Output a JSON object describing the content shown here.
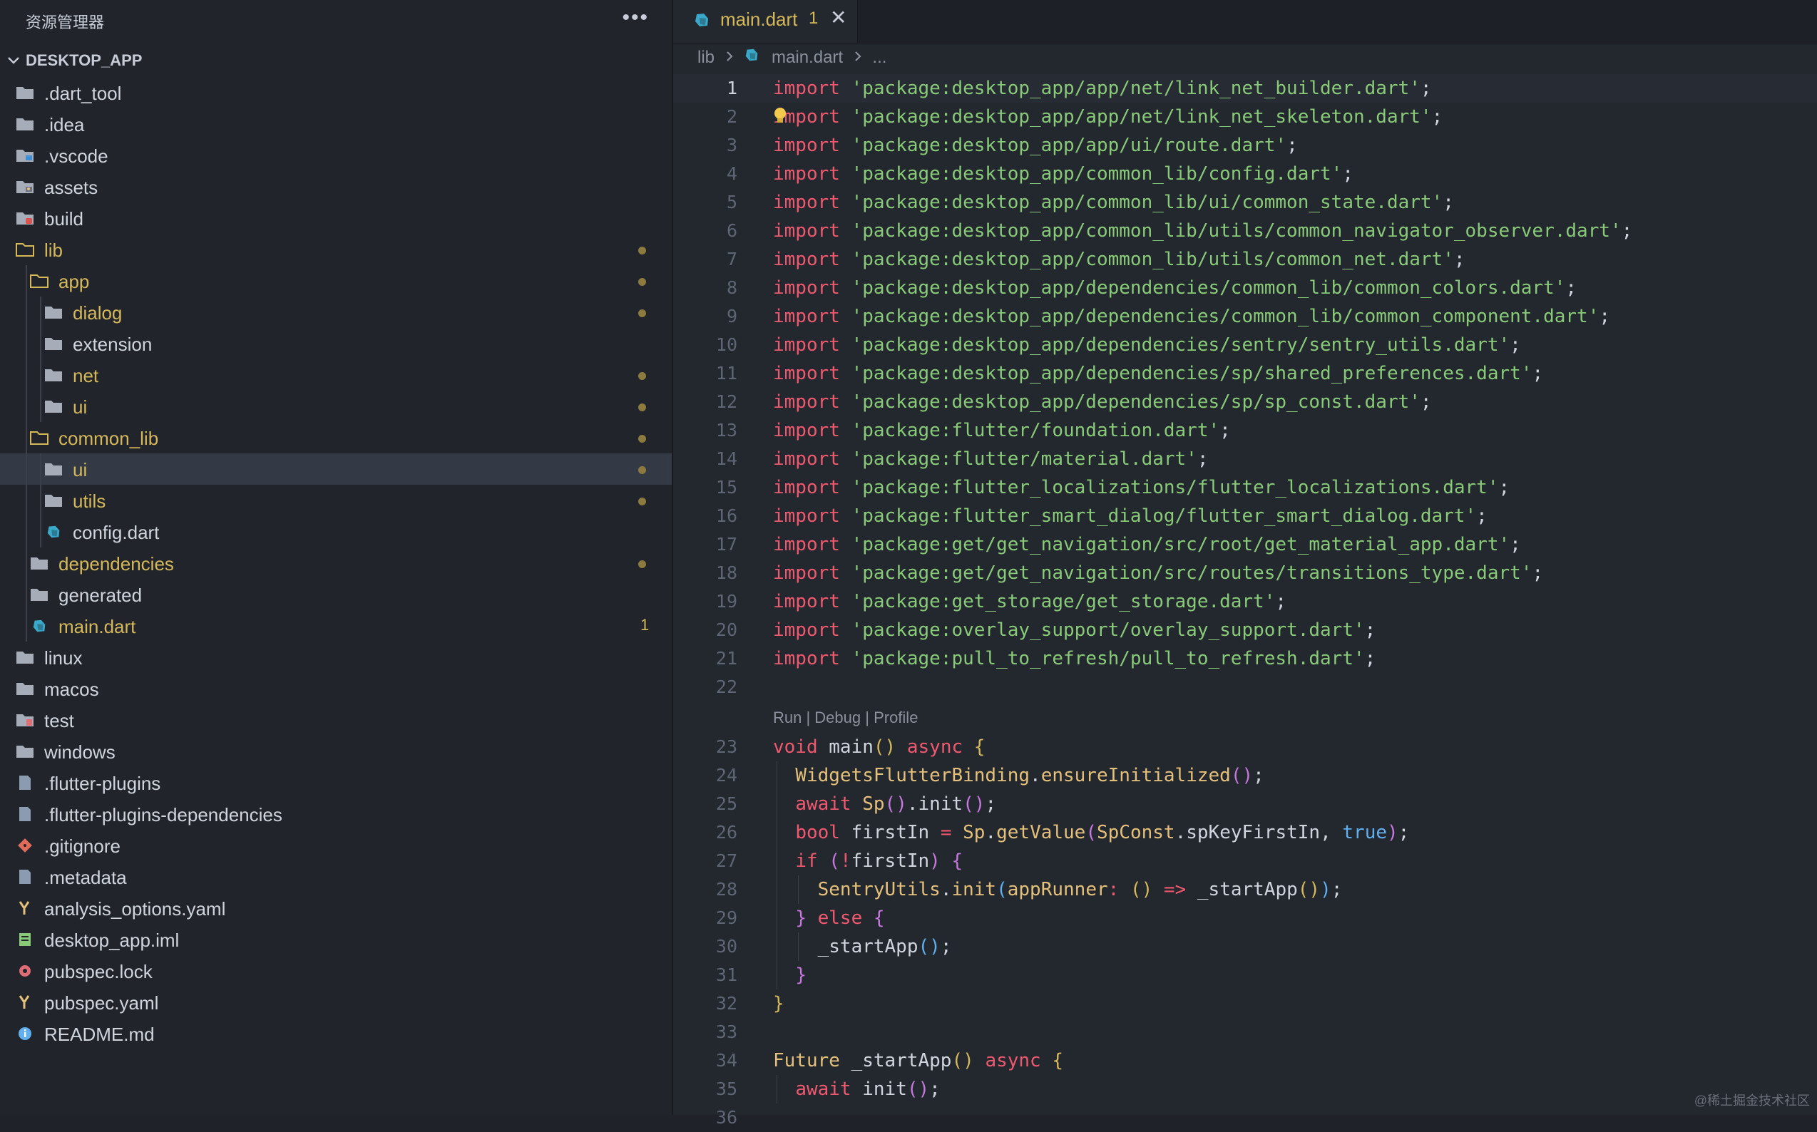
{
  "sidebar": {
    "title": "资源管理器",
    "more": "•••",
    "root": "DESKTOP_APP",
    "items": [
      {
        "label": ".dart_tool",
        "icon": "folder-icon",
        "depth": 0,
        "mod": false,
        "dot": false
      },
      {
        "label": ".idea",
        "icon": "folder-icon",
        "depth": 0,
        "mod": false,
        "dot": false
      },
      {
        "label": ".vscode",
        "icon": "vscode-folder-icon",
        "depth": 0,
        "mod": false,
        "dot": false
      },
      {
        "label": "assets",
        "icon": "assets-folder-icon",
        "depth": 0,
        "mod": false,
        "dot": false
      },
      {
        "label": "build",
        "icon": "build-folder-icon",
        "depth": 0,
        "mod": false,
        "dot": false
      },
      {
        "label": "lib",
        "icon": "folder-open-icon",
        "depth": 0,
        "mod": true,
        "dot": true
      },
      {
        "label": "app",
        "icon": "folder-open-icon",
        "depth": 1,
        "mod": true,
        "dot": true
      },
      {
        "label": "dialog",
        "icon": "folder-icon",
        "depth": 2,
        "mod": true,
        "dot": true
      },
      {
        "label": "extension",
        "icon": "folder-icon",
        "depth": 2,
        "mod": false,
        "dot": false
      },
      {
        "label": "net",
        "icon": "folder-icon",
        "depth": 2,
        "mod": true,
        "dot": true
      },
      {
        "label": "ui",
        "icon": "folder-icon",
        "depth": 2,
        "mod": true,
        "dot": true
      },
      {
        "label": "common_lib",
        "icon": "folder-open-icon",
        "depth": 1,
        "mod": true,
        "dot": true
      },
      {
        "label": "ui",
        "icon": "folder-icon",
        "depth": 2,
        "mod": true,
        "dot": true,
        "selected": true
      },
      {
        "label": "utils",
        "icon": "folder-icon",
        "depth": 2,
        "mod": true,
        "dot": true
      },
      {
        "label": "config.dart",
        "icon": "dart-file-icon",
        "depth": 2,
        "mod": false,
        "dot": false
      },
      {
        "label": "dependencies",
        "icon": "folder-icon",
        "depth": 1,
        "mod": true,
        "dot": true
      },
      {
        "label": "generated",
        "icon": "folder-icon",
        "depth": 1,
        "mod": false,
        "dot": false
      },
      {
        "label": "main.dart",
        "icon": "dart-file-icon",
        "depth": 1,
        "mod": true,
        "dot": false,
        "badge": "1"
      },
      {
        "label": "linux",
        "icon": "folder-icon",
        "depth": 0,
        "mod": false,
        "dot": false
      },
      {
        "label": "macos",
        "icon": "folder-icon",
        "depth": 0,
        "mod": false,
        "dot": false
      },
      {
        "label": "test",
        "icon": "test-folder-icon",
        "depth": 0,
        "mod": false,
        "dot": false
      },
      {
        "label": "windows",
        "icon": "folder-icon",
        "depth": 0,
        "mod": false,
        "dot": false
      },
      {
        "label": ".flutter-plugins",
        "icon": "file-icon",
        "depth": 0,
        "mod": false,
        "dot": false
      },
      {
        "label": ".flutter-plugins-dependencies",
        "icon": "file-icon",
        "depth": 0,
        "mod": false,
        "dot": false
      },
      {
        "label": ".gitignore",
        "icon": "git-icon",
        "depth": 0,
        "mod": false,
        "dot": false
      },
      {
        "label": ".metadata",
        "icon": "file-icon",
        "depth": 0,
        "mod": false,
        "dot": false
      },
      {
        "label": "analysis_options.yaml",
        "icon": "yaml-icon",
        "depth": 0,
        "mod": false,
        "dot": false
      },
      {
        "label": "desktop_app.iml",
        "icon": "iml-icon",
        "depth": 0,
        "mod": false,
        "dot": false
      },
      {
        "label": "pubspec.lock",
        "icon": "lock-icon",
        "depth": 0,
        "mod": false,
        "dot": false
      },
      {
        "label": "pubspec.yaml",
        "icon": "yaml-icon",
        "depth": 0,
        "mod": false,
        "dot": false
      },
      {
        "label": "README.md",
        "icon": "info-icon",
        "depth": 0,
        "mod": false,
        "dot": false
      }
    ]
  },
  "editor": {
    "tab": {
      "label": "main.dart",
      "badge": "1",
      "close": "✕"
    },
    "breadcrumb": {
      "seg1": "lib",
      "seg2": "main.dart",
      "seg3": "..."
    },
    "codelens": "Run | Debug | Profile",
    "lines": [
      {
        "n": "1",
        "cur": true,
        "t": [
          [
            "kw",
            "import "
          ],
          [
            "str",
            "'package:desktop_app/app/net/link_net_builder.dart'"
          ],
          [
            "pn",
            ";"
          ]
        ]
      },
      {
        "n": "2",
        "bulb": true,
        "t": [
          [
            "kw",
            "import "
          ],
          [
            "str",
            "'package:desktop_app/app/net/link_net_skeleton.dart'"
          ],
          [
            "pn",
            ";"
          ]
        ]
      },
      {
        "n": "3",
        "t": [
          [
            "kw",
            "import "
          ],
          [
            "str",
            "'package:desktop_app/app/ui/route.dart'"
          ],
          [
            "pn",
            ";"
          ]
        ]
      },
      {
        "n": "4",
        "t": [
          [
            "kw",
            "import "
          ],
          [
            "str",
            "'package:desktop_app/common_lib/config.dart'"
          ],
          [
            "pn",
            ";"
          ]
        ]
      },
      {
        "n": "5",
        "t": [
          [
            "kw",
            "import "
          ],
          [
            "str",
            "'package:desktop_app/common_lib/ui/common_state.dart'"
          ],
          [
            "pn",
            ";"
          ]
        ]
      },
      {
        "n": "6",
        "t": [
          [
            "kw",
            "import "
          ],
          [
            "str",
            "'package:desktop_app/common_lib/utils/common_navigator_observer.dart'"
          ],
          [
            "pn",
            ";"
          ]
        ]
      },
      {
        "n": "7",
        "t": [
          [
            "kw",
            "import "
          ],
          [
            "str",
            "'package:desktop_app/common_lib/utils/common_net.dart'"
          ],
          [
            "pn",
            ";"
          ]
        ]
      },
      {
        "n": "8",
        "t": [
          [
            "kw",
            "import "
          ],
          [
            "str",
            "'package:desktop_app/dependencies/common_lib/common_colors.dart'"
          ],
          [
            "pn",
            ";"
          ]
        ]
      },
      {
        "n": "9",
        "t": [
          [
            "kw",
            "import "
          ],
          [
            "str",
            "'package:desktop_app/dependencies/common_lib/common_component.dart'"
          ],
          [
            "pn",
            ";"
          ]
        ]
      },
      {
        "n": "10",
        "t": [
          [
            "kw",
            "import "
          ],
          [
            "str",
            "'package:desktop_app/dependencies/sentry/sentry_utils.dart'"
          ],
          [
            "pn",
            ";"
          ]
        ]
      },
      {
        "n": "11",
        "t": [
          [
            "kw",
            "import "
          ],
          [
            "str",
            "'package:desktop_app/dependencies/sp/shared_preferences.dart'"
          ],
          [
            "pn",
            ";"
          ]
        ]
      },
      {
        "n": "12",
        "t": [
          [
            "kw",
            "import "
          ],
          [
            "str",
            "'package:desktop_app/dependencies/sp/sp_const.dart'"
          ],
          [
            "pn",
            ";"
          ]
        ]
      },
      {
        "n": "13",
        "t": [
          [
            "kw",
            "import "
          ],
          [
            "str",
            "'package:flutter/foundation.dart'"
          ],
          [
            "pn",
            ";"
          ]
        ]
      },
      {
        "n": "14",
        "t": [
          [
            "kw",
            "import "
          ],
          [
            "str",
            "'package:flutter/material.dart'"
          ],
          [
            "pn",
            ";"
          ]
        ]
      },
      {
        "n": "15",
        "t": [
          [
            "kw",
            "import "
          ],
          [
            "str",
            "'package:flutter_localizations/flutter_localizations.dart'"
          ],
          [
            "pn",
            ";"
          ]
        ]
      },
      {
        "n": "16",
        "t": [
          [
            "kw",
            "import "
          ],
          [
            "str",
            "'package:flutter_smart_dialog/flutter_smart_dialog.dart'"
          ],
          [
            "pn",
            ";"
          ]
        ]
      },
      {
        "n": "17",
        "t": [
          [
            "kw",
            "import "
          ],
          [
            "str",
            "'package:get/get_navigation/src/root/get_material_app.dart'"
          ],
          [
            "pn",
            ";"
          ]
        ]
      },
      {
        "n": "18",
        "t": [
          [
            "kw",
            "import "
          ],
          [
            "str",
            "'package:get/get_navigation/src/routes/transitions_type.dart'"
          ],
          [
            "pn",
            ";"
          ]
        ]
      },
      {
        "n": "19",
        "t": [
          [
            "kw",
            "import "
          ],
          [
            "str",
            "'package:get_storage/get_storage.dart'"
          ],
          [
            "pn",
            ";"
          ]
        ]
      },
      {
        "n": "20",
        "t": [
          [
            "kw",
            "import "
          ],
          [
            "str",
            "'package:overlay_support/overlay_support.dart'"
          ],
          [
            "pn",
            ";"
          ]
        ]
      },
      {
        "n": "21",
        "t": [
          [
            "kw",
            "import "
          ],
          [
            "str",
            "'package:pull_to_refresh/pull_to_refresh.dart'"
          ],
          [
            "pn",
            ";"
          ]
        ]
      },
      {
        "n": "22",
        "t": []
      },
      {
        "lens": true
      },
      {
        "n": "23",
        "t": [
          [
            "kw",
            "void "
          ],
          [
            "pn",
            "main"
          ],
          [
            "br1",
            "()"
          ],
          [
            "pn",
            " "
          ],
          [
            "kw",
            "async "
          ],
          [
            "br1",
            "{"
          ]
        ]
      },
      {
        "n": "24",
        "ind": 1,
        "t": [
          [
            "pn",
            "  "
          ],
          [
            "ty",
            "WidgetsFlutterBinding"
          ],
          [
            "pn",
            "."
          ],
          [
            "ty",
            "ensureInitialized"
          ],
          [
            "br2",
            "()"
          ],
          [
            "pn",
            ";"
          ]
        ]
      },
      {
        "n": "25",
        "ind": 1,
        "t": [
          [
            "pn",
            "  "
          ],
          [
            "kw",
            "await "
          ],
          [
            "ty",
            "Sp"
          ],
          [
            "br2",
            "()"
          ],
          [
            "pn",
            ".init"
          ],
          [
            "br2",
            "()"
          ],
          [
            "pn",
            ";"
          ]
        ]
      },
      {
        "n": "26",
        "ind": 1,
        "t": [
          [
            "pn",
            "  "
          ],
          [
            "kw",
            "bool "
          ],
          [
            "pn",
            "firstIn "
          ],
          [
            "kw",
            "= "
          ],
          [
            "ty",
            "Sp"
          ],
          [
            "pn",
            "."
          ],
          [
            "ty",
            "getValue"
          ],
          [
            "br2",
            "("
          ],
          [
            "ty",
            "SpConst"
          ],
          [
            "pn",
            ".spKeyFirstIn, "
          ],
          [
            "bool",
            "true"
          ],
          [
            "br2",
            ")"
          ],
          [
            "pn",
            ";"
          ]
        ]
      },
      {
        "n": "27",
        "ind": 1,
        "t": [
          [
            "pn",
            "  "
          ],
          [
            "kw",
            "if "
          ],
          [
            "br2",
            "("
          ],
          [
            "kw",
            "!"
          ],
          [
            "pn",
            "firstIn"
          ],
          [
            "br2",
            ")"
          ],
          [
            "pn",
            " "
          ],
          [
            "br2",
            "{"
          ]
        ]
      },
      {
        "n": "28",
        "ind": 2,
        "t": [
          [
            "pn",
            "    "
          ],
          [
            "ty",
            "SentryUtils"
          ],
          [
            "pn",
            "."
          ],
          [
            "ty",
            "init"
          ],
          [
            "br3",
            "("
          ],
          [
            "ty",
            "appRunner"
          ],
          [
            "kw",
            ": "
          ],
          [
            "br1",
            "()"
          ],
          [
            "pn",
            " "
          ],
          [
            "kw",
            "=> "
          ],
          [
            "pn",
            "_startApp"
          ],
          [
            "br1",
            "()"
          ],
          [
            "br3",
            ")"
          ],
          [
            "pn",
            ";"
          ]
        ]
      },
      {
        "n": "29",
        "ind": 1,
        "t": [
          [
            "pn",
            "  "
          ],
          [
            "br2",
            "}"
          ],
          [
            "pn",
            " "
          ],
          [
            "kw",
            "else "
          ],
          [
            "br2",
            "{"
          ]
        ]
      },
      {
        "n": "30",
        "ind": 2,
        "t": [
          [
            "pn",
            "    _startApp"
          ],
          [
            "br3",
            "()"
          ],
          [
            "pn",
            ";"
          ]
        ]
      },
      {
        "n": "31",
        "ind": 1,
        "t": [
          [
            "pn",
            "  "
          ],
          [
            "br2",
            "}"
          ]
        ]
      },
      {
        "n": "32",
        "t": [
          [
            "br1",
            "}"
          ]
        ]
      },
      {
        "n": "33",
        "t": []
      },
      {
        "n": "34",
        "t": [
          [
            "ty",
            "Future "
          ],
          [
            "pn",
            "_startApp"
          ],
          [
            "br1",
            "()"
          ],
          [
            "pn",
            " "
          ],
          [
            "kw",
            "async "
          ],
          [
            "br1",
            "{"
          ]
        ]
      },
      {
        "n": "35",
        "ind": 1,
        "t": [
          [
            "pn",
            "  "
          ],
          [
            "kw",
            "await "
          ],
          [
            "pn",
            "init"
          ],
          [
            "br2",
            "()"
          ],
          [
            "pn",
            ";"
          ]
        ]
      },
      {
        "n": "36",
        "t": []
      }
    ]
  },
  "watermark": "@稀土掘金技术社区",
  "colors": {
    "accent_modified": "#d5b85a",
    "keyword": "#ef596f",
    "string": "#89ca78",
    "type": "#e5c07b"
  }
}
